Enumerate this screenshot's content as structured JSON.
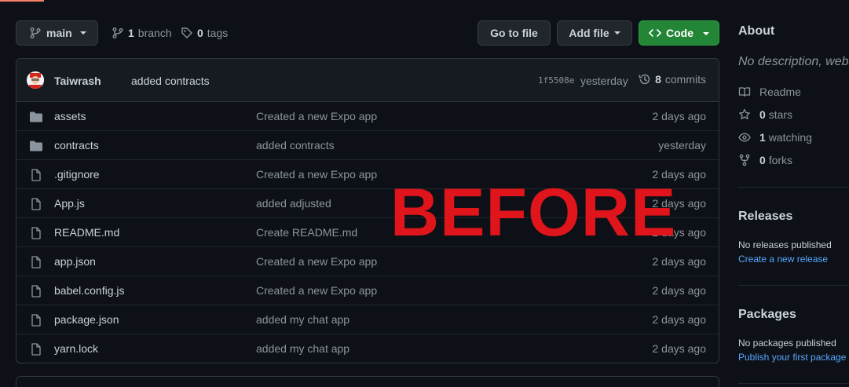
{
  "toolbar": {
    "branch": "main",
    "branch_count": "1",
    "branch_label": "branch",
    "tag_count": "0",
    "tag_label": "tags",
    "go_to_file": "Go to file",
    "add_file": "Add file",
    "code": "Code"
  },
  "commit": {
    "author": "Taiwrash",
    "message": "added contracts",
    "hash": "1f5508e",
    "time": "yesterday",
    "commit_count": "8",
    "commit_label": "commits"
  },
  "files": [
    {
      "type": "folder",
      "name": "assets",
      "commit": "Created a new Expo app",
      "age": "2 days ago"
    },
    {
      "type": "folder",
      "name": "contracts",
      "commit": "added contracts",
      "age": "yesterday"
    },
    {
      "type": "file",
      "name": ".gitignore",
      "commit": "Created a new Expo app",
      "age": "2 days ago"
    },
    {
      "type": "file",
      "name": "App.js",
      "commit": "added adjusted",
      "age": "2 days ago"
    },
    {
      "type": "file",
      "name": "README.md",
      "commit": "Create README.md",
      "age": "2 days ago"
    },
    {
      "type": "file",
      "name": "app.json",
      "commit": "Created a new Expo app",
      "age": "2 days ago"
    },
    {
      "type": "file",
      "name": "babel.config.js",
      "commit": "Created a new Expo app",
      "age": "2 days ago"
    },
    {
      "type": "file",
      "name": "package.json",
      "commit": "added my chat app",
      "age": "2 days ago"
    },
    {
      "type": "file",
      "name": "yarn.lock",
      "commit": "added my chat app",
      "age": "2 days ago"
    }
  ],
  "watermark": "BEFORE",
  "sidebar": {
    "about_title": "About",
    "about_desc": "No description, website, or topics provided.",
    "readme": "Readme",
    "stars_count": "0",
    "stars_label": "stars",
    "watching_count": "1",
    "watching_label": "watching",
    "forks_count": "0",
    "forks_label": "forks",
    "releases_title": "Releases",
    "releases_empty": "No releases published",
    "releases_link": "Create a new release",
    "packages_title": "Packages",
    "packages_empty": "No packages published",
    "packages_link": "Publish your first package"
  },
  "colors": {
    "background": "#0d1117",
    "code_button": "#238636",
    "link": "#58a6ff",
    "watermark": "#e0141b"
  }
}
